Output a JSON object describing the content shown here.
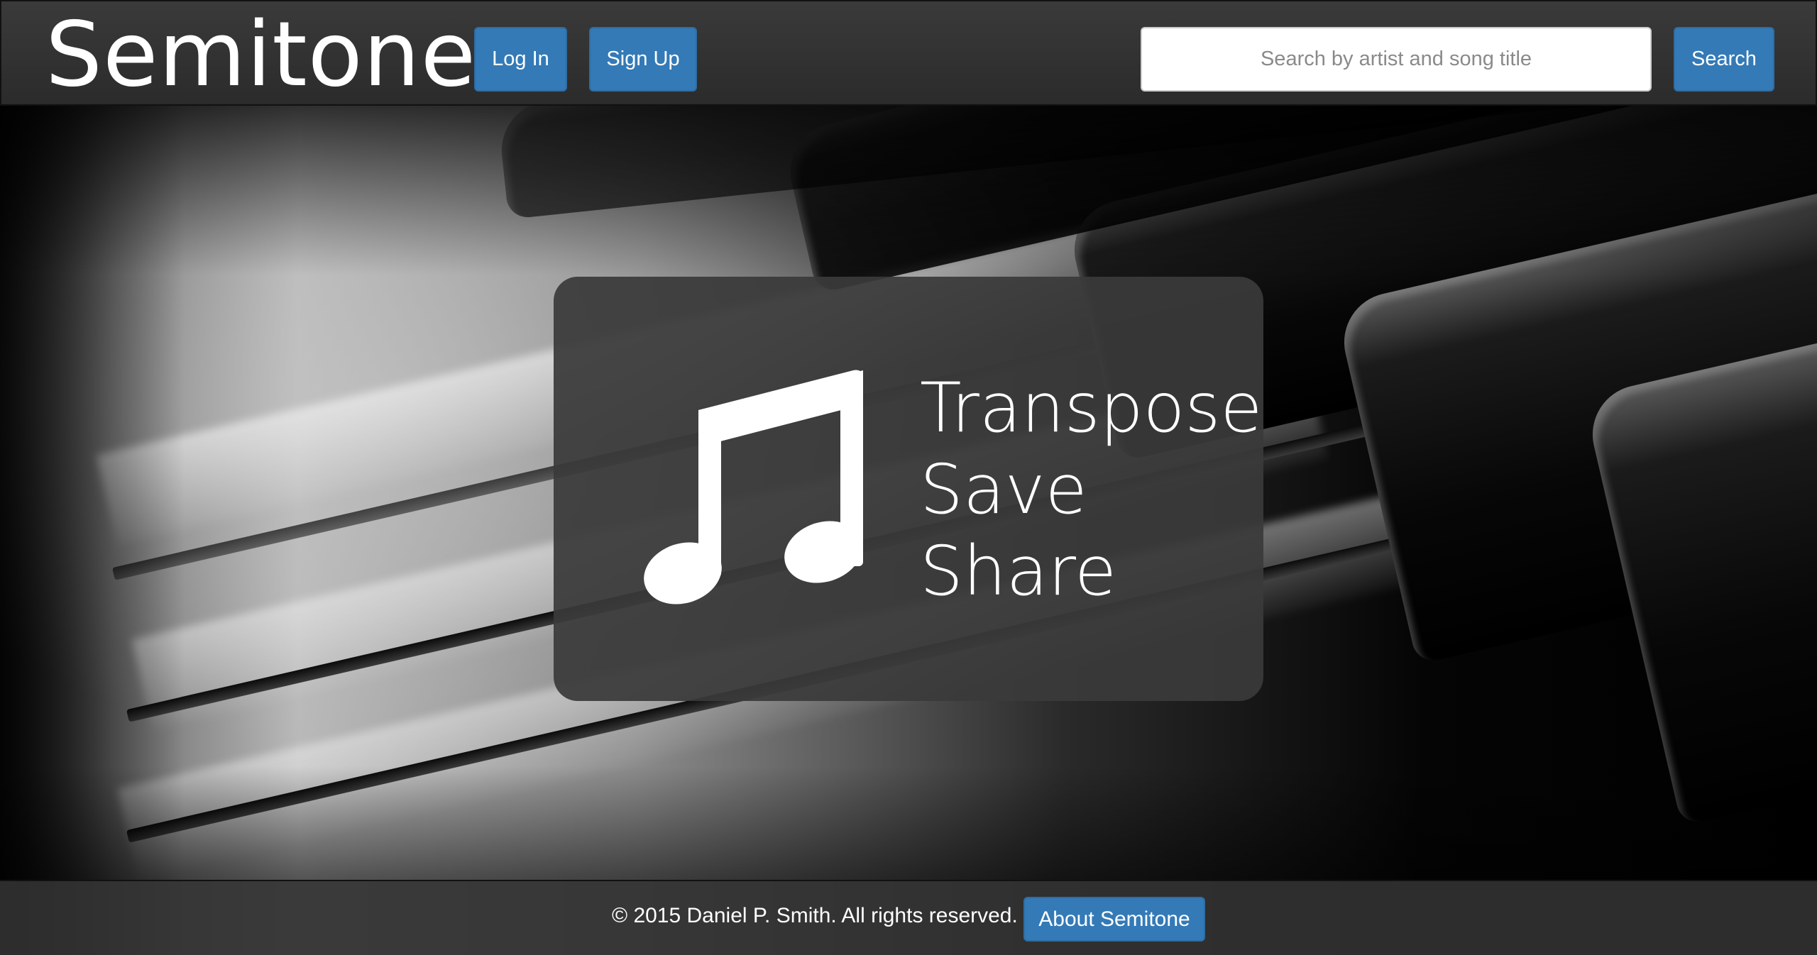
{
  "header": {
    "brand": "Semitone",
    "login_label": "Log In",
    "signup_label": "Sign Up",
    "search": {
      "placeholder": "Search by artist and song title",
      "value": ""
    },
    "search_label": "Search"
  },
  "hero": {
    "background": "piano-keys-photo",
    "icon": "music-note-icon",
    "taglines": [
      "Transpose",
      "Save",
      "Share"
    ]
  },
  "footer": {
    "copyright": "© 2015 Daniel P. Smith. All rights reserved.",
    "about_label": "About Semitone"
  },
  "colors": {
    "accent": "#337ab7",
    "header_bg": "#333333",
    "card_bg": "#3a3a3a",
    "text": "#ffffff"
  }
}
